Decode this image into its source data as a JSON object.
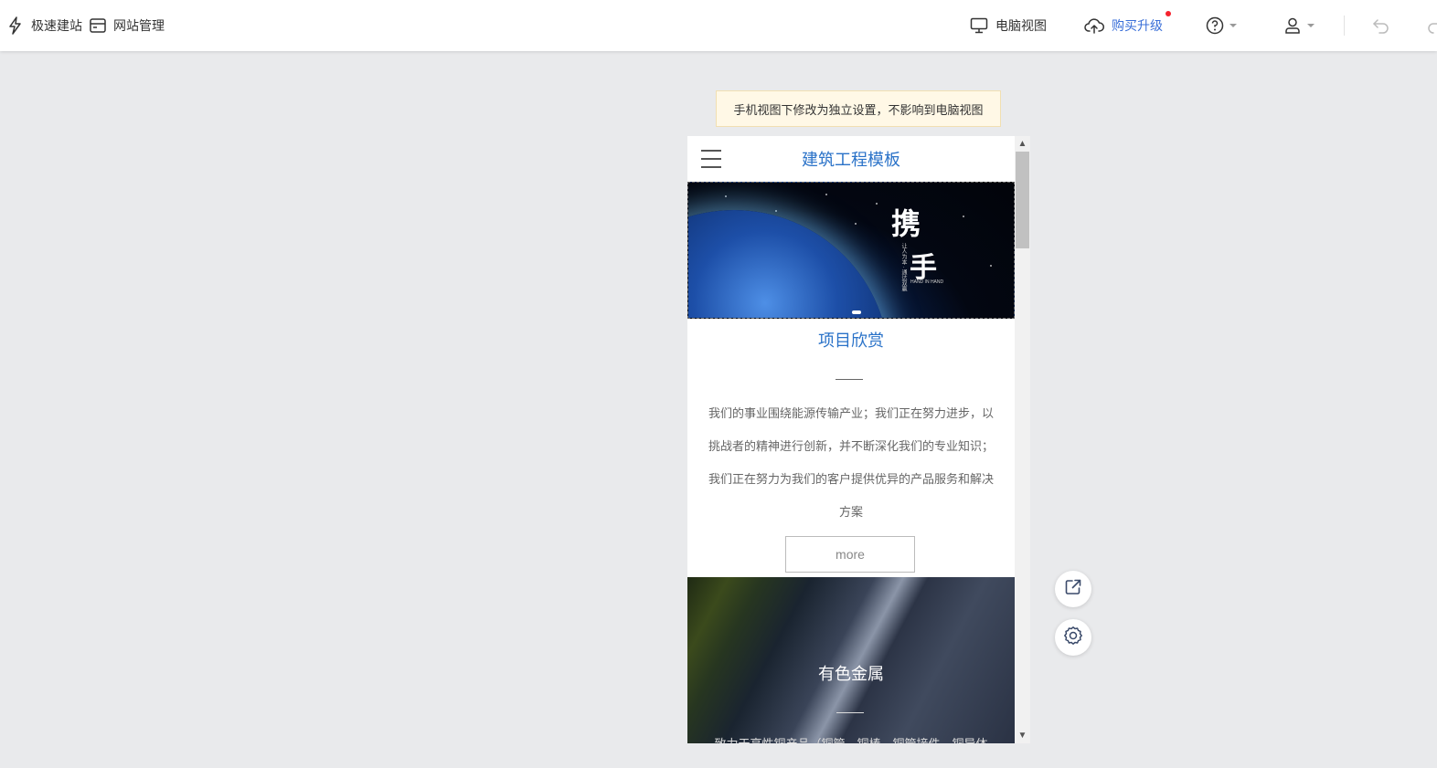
{
  "toolbar": {
    "quick_build": "极速建站",
    "site_manage": "网站管理",
    "pc_view": "电脑视图",
    "upgrade": "购买升级"
  },
  "notice": "手机视图下修改为独立设置，不影响到电脑视图",
  "preview": {
    "site_title": "建筑工程模板",
    "banner": {
      "char1": "携",
      "char2": "手",
      "sub": "让人为本 · 通达双赢",
      "en": "HAND IN HAND"
    },
    "section1": {
      "title": "项目欣赏",
      "text": "我们的事业围绕能源传输产业；我们正在努力进步，以挑战者的精神进行创新，并不断深化我们的专业知识；我们正在努力为我们的客户提供优异的产品服务和解决方案",
      "more": "more"
    },
    "section2": {
      "title": "有色金属",
      "text": "致力于高性铜产品（铜管、铜棒、铜管接件、铜导体"
    }
  },
  "colors": {
    "accent": "#2a72c8",
    "upgrade": "#3a6fd8",
    "notice_bg": "#fff8e6",
    "badge": "#f5222d"
  },
  "icons": {
    "quick_build": "lightning-icon",
    "site_manage": "card-icon",
    "pc_view": "monitor-icon",
    "upgrade": "cloud-upload-icon",
    "help": "question-circle-icon",
    "user": "user-icon",
    "undo": "undo-icon",
    "redo": "redo-icon",
    "share": "share-icon",
    "settings": "gear-icon"
  }
}
